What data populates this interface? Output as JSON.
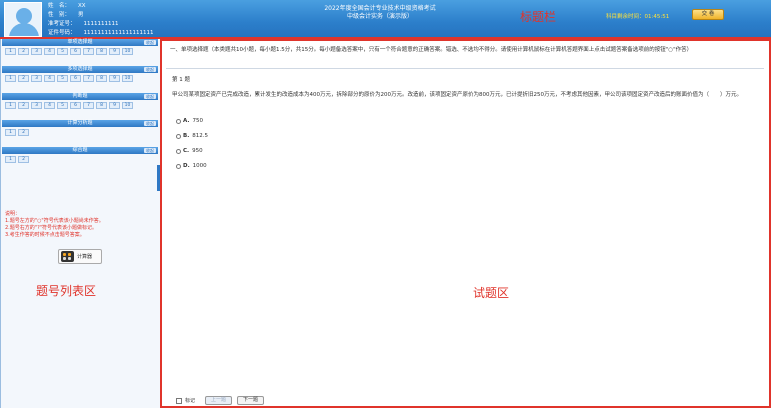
{
  "candidate": {
    "name_label": "姓　名：",
    "name_value": "XX",
    "gender_label": "性　别：",
    "gender_value": "男",
    "exam_no_label": "准考证号：",
    "exam_no_value": "1111111111",
    "id_label": "证件号码：",
    "id_value": "11111111111111111111"
  },
  "header": {
    "title_line1": "2022年度全国会计专业技术中级资格考试",
    "title_line2": "中级会计实务（演示版）",
    "annotation": "标题栏",
    "timer_label": "科目剩余时间：",
    "timer_value": "01:45:51",
    "submit_label": "交 卷"
  },
  "sidebar": {
    "collapse_label": "收起",
    "sections": [
      {
        "title": "单项选择题",
        "rows": [
          [
            "1",
            "2",
            "3",
            "4",
            "5",
            "6",
            "7",
            "8",
            "9",
            "10"
          ]
        ]
      },
      {
        "title": "多项选择题",
        "rows": [
          [
            "1",
            "2",
            "3",
            "4",
            "5",
            "6",
            "7",
            "8",
            "9",
            "10"
          ]
        ]
      },
      {
        "title": "判断题",
        "rows": [
          [
            "1",
            "2",
            "3",
            "4",
            "5",
            "6",
            "7",
            "8",
            "9",
            "10"
          ]
        ]
      },
      {
        "title": "计算分析题",
        "rows": [
          [
            "1",
            "2"
          ]
        ]
      },
      {
        "title": "综合题",
        "rows": [
          [
            "1",
            "2"
          ]
        ]
      }
    ],
    "notes": [
      "说明：",
      "1.题号左方的\"○\"符号代表该小题尚未作答。",
      "2.题号右方的\"?\"符号代表该小题做标记。",
      "3.考生作答的时候不点击题号答案。"
    ],
    "calculator_label": "计算器",
    "annotation": "题号列表区"
  },
  "question": {
    "instructions": "一、单项选择题（本类题共10小题，每小题1.5分，共15分。每小题备选答案中，只有一个符合题意的正确答案。错选、不选均不得分。请使用计算机鼠标在计算机答题界面上点击试题答案备选项前的按钮\"○\"作答）",
    "number": "第 1 题",
    "stem": "甲公司某项固定资产已完成改造，累计发生的改造成本为400万元，拆除部分的原价为200万元。改造前，该项固定资产原价为800万元，已计提折旧250万元，不考虑其他因素，甲公司该项固定资产改造后的账面价值为（　　）万元。",
    "options": [
      {
        "key": "A.",
        "text": "750"
      },
      {
        "key": "B.",
        "text": "812.5"
      },
      {
        "key": "C.",
        "text": "950"
      },
      {
        "key": "D.",
        "text": "1000"
      }
    ],
    "annotation": "试题区",
    "mark_label": "标记",
    "prev_label": "上一题",
    "next_label": "下一题"
  },
  "colors": {
    "header_blue": "#2c7fcb",
    "annotation_red": "#e0342b",
    "timer_yellow": "#ffe23a"
  }
}
